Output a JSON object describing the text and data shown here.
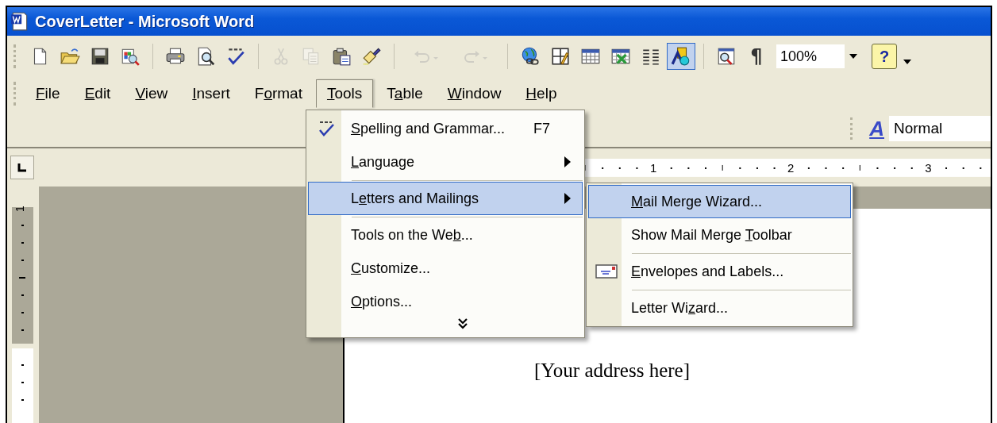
{
  "window": {
    "title": "CoverLetter - Microsoft Word"
  },
  "standard_toolbar": {
    "buttons": [
      {
        "kind": "new",
        "disabled": false,
        "on": false
      },
      {
        "kind": "open",
        "disabled": false,
        "on": false
      },
      {
        "kind": "save",
        "disabled": false,
        "on": false
      },
      {
        "kind": "permission",
        "disabled": false,
        "on": false
      },
      {
        "kind": "separator"
      },
      {
        "kind": "print",
        "disabled": false,
        "on": false
      },
      {
        "kind": "preview",
        "disabled": false,
        "on": false
      },
      {
        "kind": "spelling",
        "disabled": false,
        "on": false
      },
      {
        "kind": "separator"
      },
      {
        "kind": "cut",
        "disabled": true,
        "on": false
      },
      {
        "kind": "copy",
        "disabled": true,
        "on": false
      },
      {
        "kind": "paste",
        "disabled": false,
        "on": false
      },
      {
        "kind": "painter",
        "disabled": false,
        "on": false
      },
      {
        "kind": "separator"
      },
      {
        "kind": "undo",
        "disabled": true,
        "on": false
      },
      {
        "kind": "redo",
        "disabled": true,
        "on": false
      },
      {
        "kind": "separator"
      },
      {
        "kind": "hyperlink",
        "disabled": false,
        "on": false
      },
      {
        "kind": "borders",
        "disabled": false,
        "on": false
      },
      {
        "kind": "table",
        "disabled": false,
        "on": false
      },
      {
        "kind": "sheet",
        "disabled": false,
        "on": false
      },
      {
        "kind": "columns",
        "disabled": false,
        "on": false
      },
      {
        "kind": "drawing",
        "disabled": false,
        "on": true
      },
      {
        "kind": "separator"
      },
      {
        "kind": "docmap",
        "disabled": false,
        "on": false
      },
      {
        "kind": "marks",
        "label": "¶",
        "disabled": false,
        "on": false
      }
    ],
    "zoom": "100%",
    "help_label": "?"
  },
  "menu_bar": [
    {
      "label": "File",
      "selected": false
    },
    {
      "label": "Edit",
      "selected": false
    },
    {
      "label": "View",
      "selected": false
    },
    {
      "label": "Insert",
      "selected": false
    },
    {
      "label": "Format",
      "selected": false
    },
    {
      "label": "Tools",
      "selected": true
    },
    {
      "label": "Table",
      "selected": false
    },
    {
      "label": "Window",
      "selected": false
    },
    {
      "label": "Help",
      "selected": false
    }
  ],
  "formatting_toolbar": {
    "styles_icon_label": "A",
    "style": "Normal"
  },
  "ruler": {
    "labels": [
      "1",
      "2",
      "3"
    ]
  },
  "vertical_ruler": {
    "label": "1"
  },
  "tools_menu": {
    "items": [
      {
        "kind": "spelling-item",
        "label": "Spelling and Grammar...",
        "shortcut": "F7",
        "submenu": false,
        "selected": false
      },
      {
        "kind": "item",
        "label": "Language",
        "submenu": true,
        "selected": false
      },
      {
        "kind": "separator"
      },
      {
        "kind": "item",
        "label": "Letters and Mailings",
        "submenu": true,
        "selected": true
      },
      {
        "kind": "separator"
      },
      {
        "kind": "item",
        "label": "Tools on the Web...",
        "submenu": false,
        "selected": false
      },
      {
        "kind": "item",
        "label": "Customize...",
        "submenu": false,
        "selected": false
      },
      {
        "kind": "item",
        "label": "Options...",
        "submenu": false,
        "selected": false
      },
      {
        "kind": "more"
      }
    ]
  },
  "mailings_submenu": {
    "items": [
      {
        "kind": "item",
        "label": "Mail Merge Wizard...",
        "submenu": false,
        "selected": true
      },
      {
        "kind": "item",
        "label": "Show Mail Merge Toolbar",
        "submenu": false,
        "selected": false
      },
      {
        "kind": "separator"
      },
      {
        "kind": "envelope-item",
        "label": "Envelopes and Labels...",
        "submenu": false,
        "selected": false
      },
      {
        "kind": "separator"
      },
      {
        "kind": "item",
        "label": "Letter Wizard...",
        "submenu": false,
        "selected": false
      }
    ]
  },
  "document": {
    "text": "[Your address here]"
  }
}
